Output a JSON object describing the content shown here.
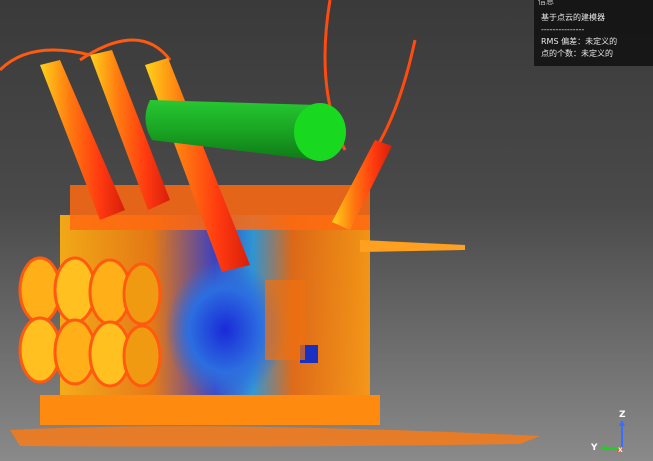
{
  "info_panel": {
    "title": "信息",
    "lines": [
      "基于点云的建模器",
      "---------------",
      "RMS 偏差：未定义的",
      "点的个数：未定义的"
    ]
  },
  "axis": {
    "z_label": "Z",
    "y_label": "Y",
    "x_label": "X"
  },
  "colors": {
    "cylinder": "#1fbf2a",
    "cylinder_cap": "#18d81f",
    "bushing": "#ff4a10",
    "background_top": "#3a3a3a",
    "background_bottom": "#8a8a8a"
  },
  "icons": [
    "axis-gizmo-icon"
  ]
}
